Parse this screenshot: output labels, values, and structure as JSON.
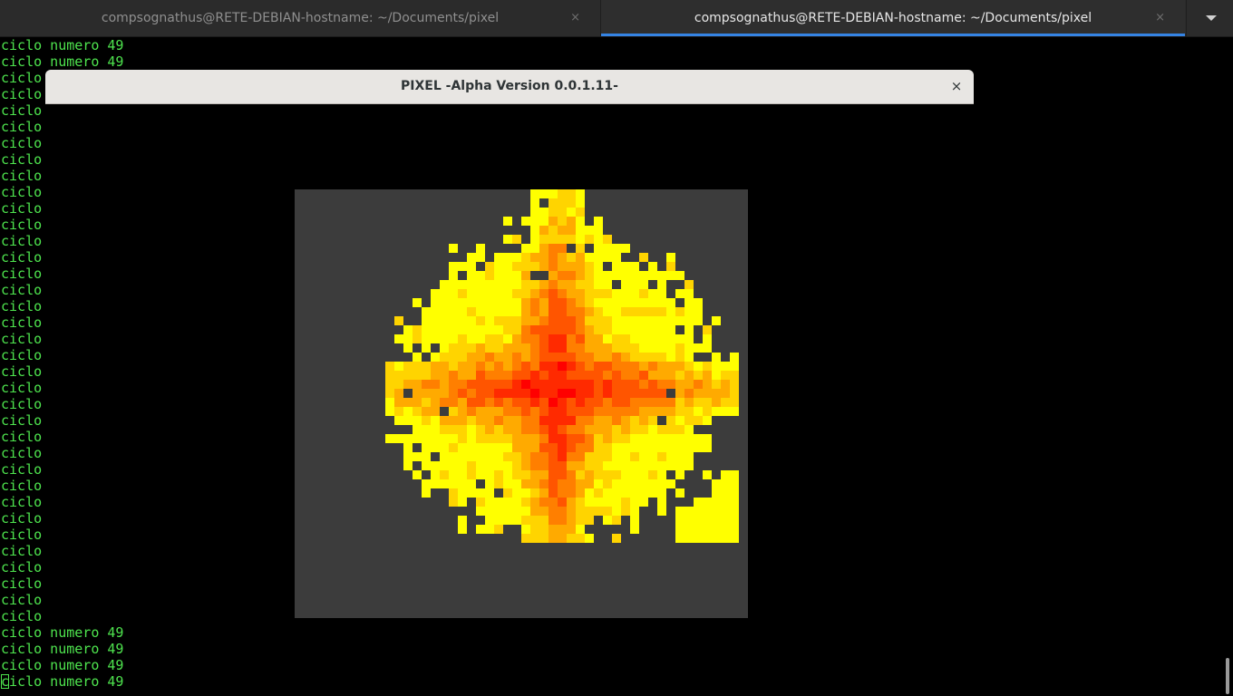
{
  "tabs": [
    {
      "title": "compsognathus@RETE-DEBIAN-hostname: ~/Documents/pixel",
      "close": "×",
      "active": false
    },
    {
      "title": "compsognathus@RETE-DEBIAN-hostname: ~/Documents/pixel",
      "close": "×",
      "active": true
    }
  ],
  "terminal": {
    "line": "ciclo numero 49",
    "line_short": "ciclo",
    "text_color": "#4ee44e"
  },
  "pixel_window": {
    "title": "PIXEL -Alpha Version 0.0.1.11-",
    "close": "×",
    "canvas_background": "#3c3c3c",
    "palette": [
      "#ffff00",
      "#ffd400",
      "#ffaa00",
      "#ff7f00",
      "#ff5500",
      "#ff2a00",
      "#ff0000"
    ]
  }
}
